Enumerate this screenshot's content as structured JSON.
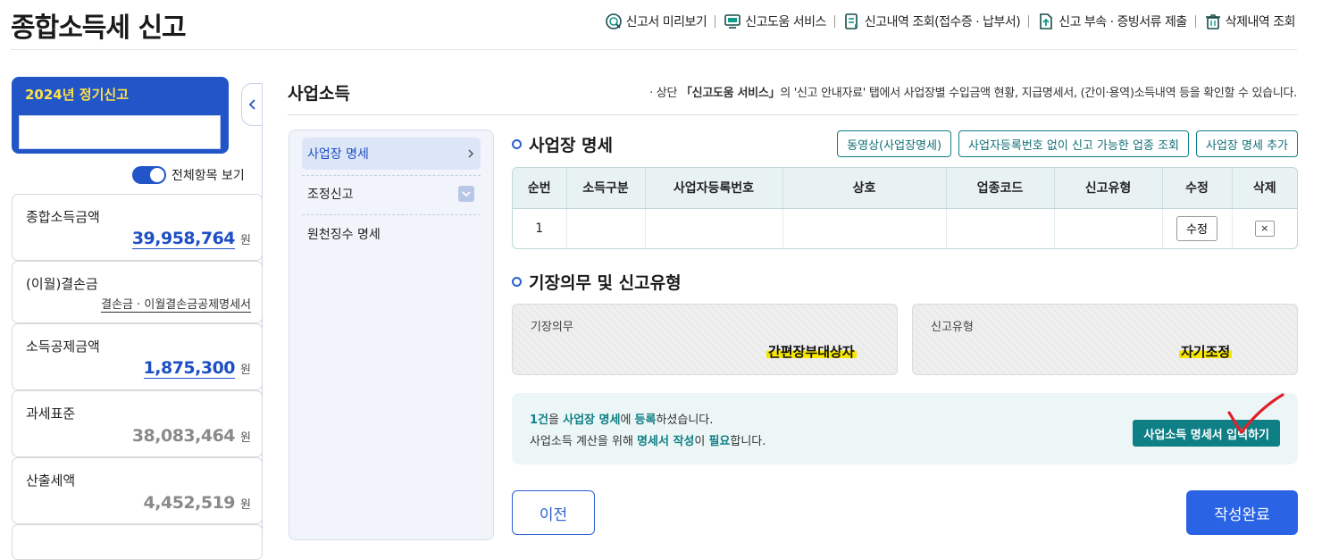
{
  "header": {
    "title": "종합소득세 신고",
    "nav": [
      {
        "label": "신고서 미리보기",
        "icon": "magnifier-doc-icon"
      },
      {
        "label": "신고도움 서비스",
        "icon": "monitor-help-icon"
      },
      {
        "label": "신고내역 조회(접수증 · 납부서)",
        "icon": "doc-list-icon"
      },
      {
        "label": "신고 부속 · 증빙서류 제출",
        "icon": "doc-upload-icon"
      },
      {
        "label": "삭제내역 조회",
        "icon": "trash-icon"
      }
    ]
  },
  "sidebar": {
    "year_label": "2024년 정기신고",
    "year_input_value": "",
    "toggle_label": "전체항목 보기",
    "toggle_on": true,
    "cards": [
      {
        "title": "종합소득금액",
        "value": "39,958,764",
        "unit": "원",
        "style": "blue"
      },
      {
        "title": "(이월)결손금",
        "link": "결손금 · 이월결손금공제명세서"
      },
      {
        "title": "소득공제금액",
        "value": "1,875,300",
        "unit": "원",
        "style": "blue"
      },
      {
        "title": "과세표준",
        "value": "38,083,464",
        "unit": "원",
        "style": "gray"
      },
      {
        "title": "산출세액",
        "value": "4,452,519",
        "unit": "원",
        "style": "gray"
      }
    ]
  },
  "main": {
    "title": "사업소득",
    "guide_prefix": "· 상단 ",
    "guide_bold": "「신고도움 서비스」",
    "guide_rest": "의 '신고 안내자료' 탭에서 사업장별 수입금액 현황, 지급명세서, (간이·용역)소득내역 등을 확인할 수 있습니다.",
    "submenu": [
      {
        "label": "사업장 명세",
        "active": true
      },
      {
        "label": "조정신고",
        "active": false
      },
      {
        "label": "원천징수 명세",
        "active": false
      }
    ],
    "biz_section": {
      "title": "사업장 명세",
      "buttons": [
        "동영상(사업장명세)",
        "사업자등록번호 없이 신고 가능한 업종 조회",
        "사업장 명세 추가"
      ],
      "columns": [
        "순번",
        "소득구분",
        "사업자등록번호",
        "상호",
        "업종코드",
        "신고유형",
        "수정",
        "삭제"
      ],
      "rows": [
        {
          "no": "1",
          "type": "",
          "reg_no": "",
          "name": "",
          "code": "",
          "report_type": "",
          "edit_label": "수정",
          "delete_label": "×"
        }
      ]
    },
    "duty_section": {
      "title": "기장의무 및 신고유형",
      "duty_label": "기장의무",
      "duty_value": "간편장부대상자",
      "type_label": "신고유형",
      "type_value": "자기조정"
    },
    "info": {
      "line1": [
        {
          "t": "1건",
          "hl": true
        },
        {
          "t": "을 ",
          "hl": false
        },
        {
          "t": "사업장 명세",
          "hl": true
        },
        {
          "t": "에 ",
          "hl": false
        },
        {
          "t": "등록",
          "hl": true
        },
        {
          "t": "하셨습니다.",
          "hl": false
        }
      ],
      "line2": [
        {
          "t": "사업소득 계산을 위해 ",
          "hl": false
        },
        {
          "t": "명세서 작성",
          "hl": true
        },
        {
          "t": "이 ",
          "hl": false
        },
        {
          "t": "필요",
          "hl": true
        },
        {
          "t": "합니다.",
          "hl": false
        }
      ],
      "button": "사업소득 명세서 입력하기"
    },
    "prev_button": "이전",
    "done_button": "작성완료"
  },
  "colors": {
    "primary": "#2255c8",
    "teal": "#0f7f86",
    "highlight": "#f6e600",
    "checkmark": "#e0202a"
  }
}
